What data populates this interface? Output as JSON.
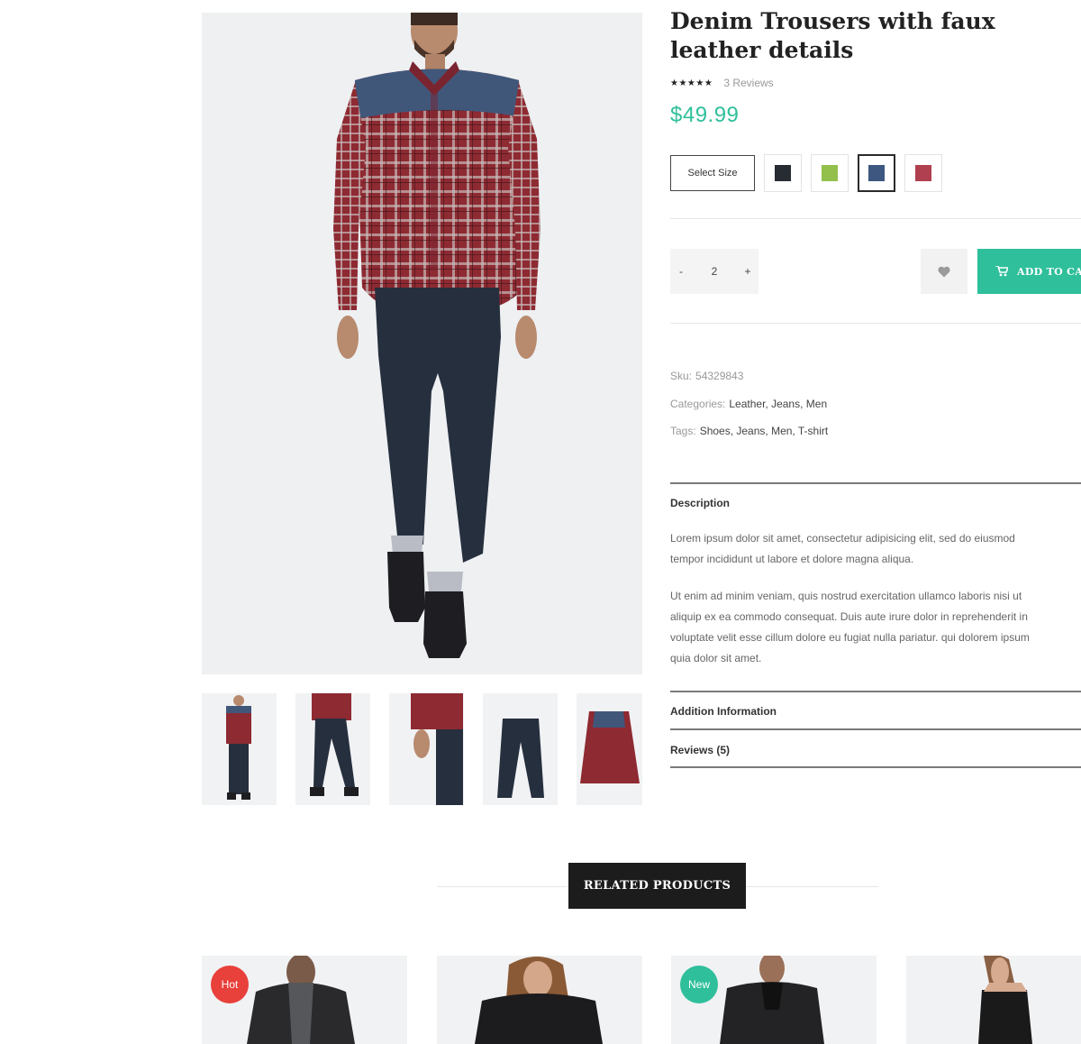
{
  "product": {
    "title": "Denim Trousers with faux leather details",
    "stars": "★★★★★",
    "reviews_link": "3 Reviews",
    "price": "$49.99",
    "rating_value": 5,
    "size_placeholder": "Select Size",
    "colors": [
      {
        "name": "black",
        "hex": "#272c33",
        "selected": false
      },
      {
        "name": "green",
        "hex": "#93c04b",
        "selected": false
      },
      {
        "name": "blue",
        "hex": "#3d5780",
        "selected": true
      },
      {
        "name": "red",
        "hex": "#b0404f",
        "selected": false
      }
    ],
    "quantity": {
      "minus": "-",
      "value": "2",
      "plus": "+"
    },
    "wishlist_icon": "heart-icon",
    "add_to_cart": "ADD TO CART",
    "cart_icon": "cart-icon",
    "sku_label": "Sku:",
    "sku_value": "54329843",
    "categories_label": "Categories:",
    "categories_value": "Leather, Jeans, Men",
    "tags_label": "Tags:",
    "tags_value": "Shoes, Jeans, Men, T-shirt"
  },
  "tabs": {
    "description_title": "Description",
    "description_p1_line1": "Lorem ipsum dolor sit amet, consectetur adipisicing elit, sed do eiusmod",
    "description_p1_line2": "tempor incididunt ut labore et dolore magna aliqua.",
    "description_p2_line1": "Ut enim ad minim veniam, quis nostrud exercitation ullamco laboris nisi ut",
    "description_p2_line2": "aliquip ex ea commodo consequat. Duis aute irure dolor in reprehenderit in",
    "description_p2_line3": "voluptate velit esse cillum dolore eu fugiat nulla pariatur. qui dolorem ipsum",
    "description_p2_line4": "quia dolor sit amet.",
    "addition_title": "Addition Information",
    "reviews_title": "Reviews (5)"
  },
  "related": {
    "heading": "RELATED PRODUCTS",
    "badges": {
      "hot": "Hot",
      "new": "New"
    },
    "colors": {
      "hot": "#e8403a",
      "new": "#2fbf9b",
      "accent": "#2fbf9b"
    }
  }
}
